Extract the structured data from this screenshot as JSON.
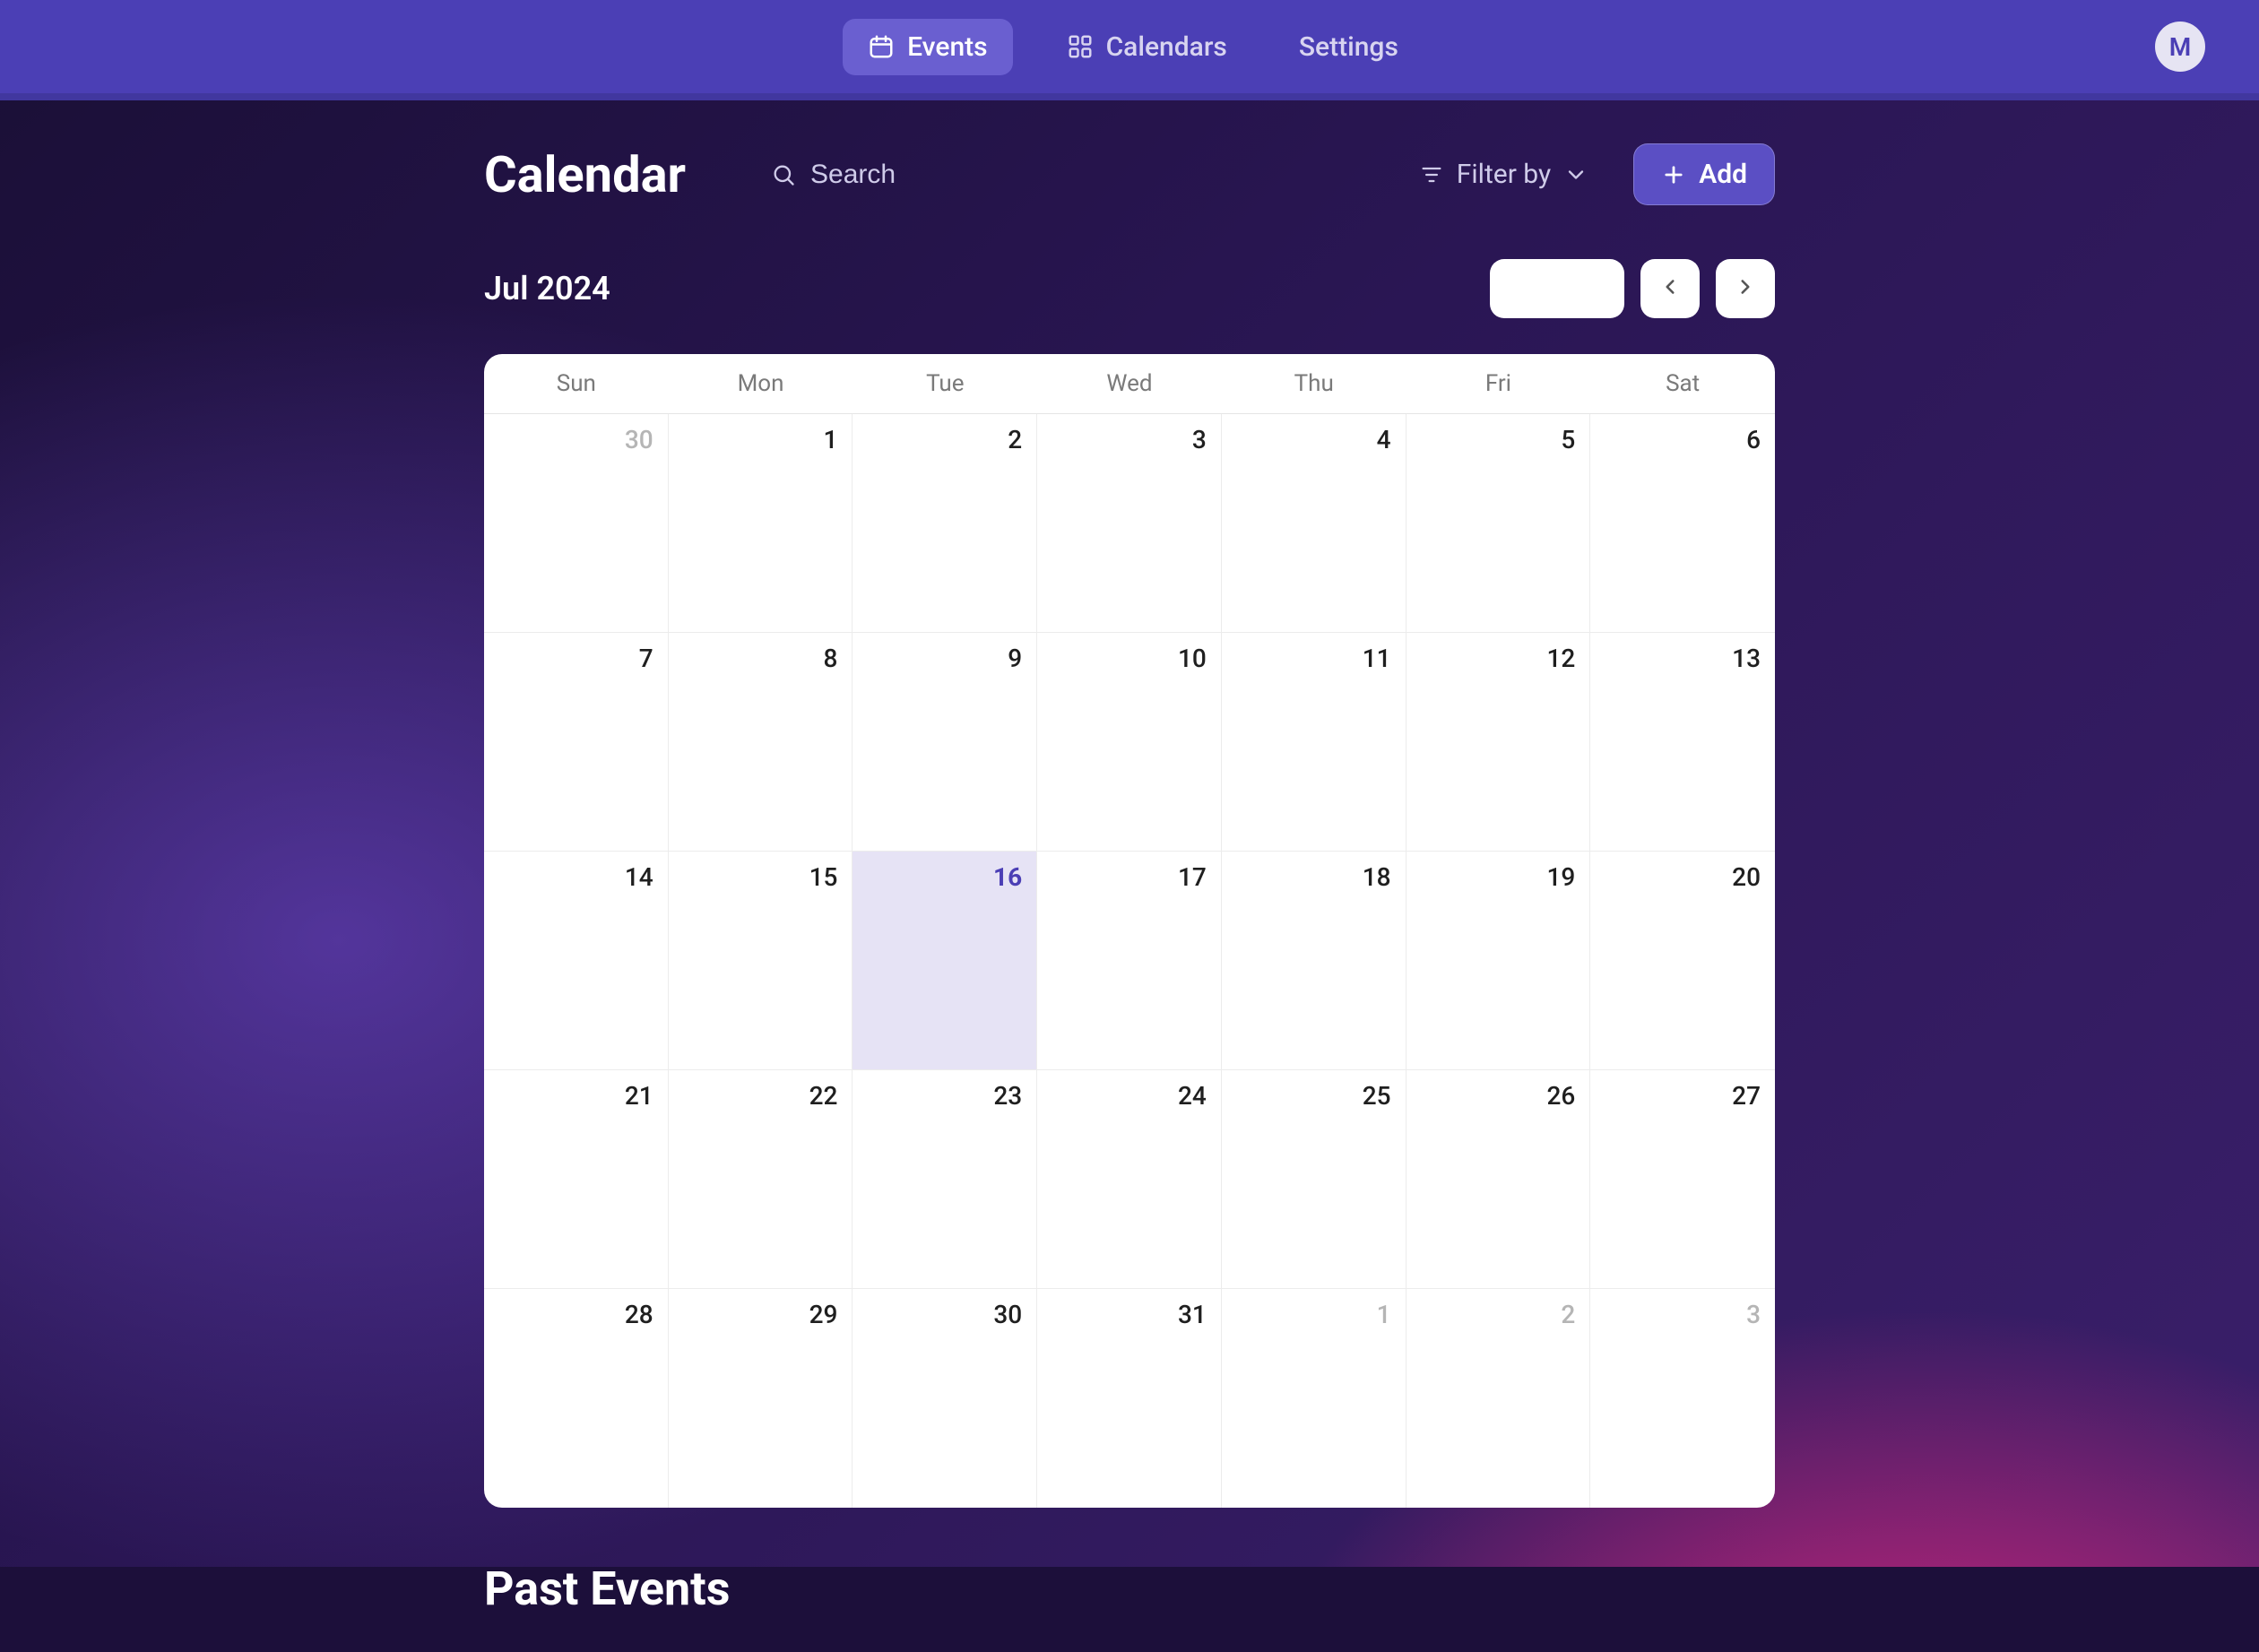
{
  "nav": {
    "tabs": [
      {
        "id": "events",
        "label": "Events",
        "icon": "calendar-icon",
        "active": true
      },
      {
        "id": "calendars",
        "label": "Calendars",
        "icon": "grid-icon",
        "active": false
      },
      {
        "id": "settings",
        "label": "Settings",
        "icon": null,
        "active": false
      }
    ],
    "avatar_initial": "M"
  },
  "header": {
    "title": "Calendar",
    "search_placeholder": "Search",
    "filter_label": "Filter by",
    "add_label": "Add"
  },
  "month": {
    "label": "Jul 2024",
    "today_label": ""
  },
  "weekdays": [
    "Sun",
    "Mon",
    "Tue",
    "Wed",
    "Thu",
    "Fri",
    "Sat"
  ],
  "weeks": [
    [
      {
        "n": "30",
        "outside": true,
        "today": false
      },
      {
        "n": "1",
        "outside": false,
        "today": false
      },
      {
        "n": "2",
        "outside": false,
        "today": false
      },
      {
        "n": "3",
        "outside": false,
        "today": false
      },
      {
        "n": "4",
        "outside": false,
        "today": false
      },
      {
        "n": "5",
        "outside": false,
        "today": false
      },
      {
        "n": "6",
        "outside": false,
        "today": false
      }
    ],
    [
      {
        "n": "7",
        "outside": false,
        "today": false
      },
      {
        "n": "8",
        "outside": false,
        "today": false
      },
      {
        "n": "9",
        "outside": false,
        "today": false
      },
      {
        "n": "10",
        "outside": false,
        "today": false
      },
      {
        "n": "11",
        "outside": false,
        "today": false
      },
      {
        "n": "12",
        "outside": false,
        "today": false
      },
      {
        "n": "13",
        "outside": false,
        "today": false
      }
    ],
    [
      {
        "n": "14",
        "outside": false,
        "today": false
      },
      {
        "n": "15",
        "outside": false,
        "today": false
      },
      {
        "n": "16",
        "outside": false,
        "today": true
      },
      {
        "n": "17",
        "outside": false,
        "today": false
      },
      {
        "n": "18",
        "outside": false,
        "today": false
      },
      {
        "n": "19",
        "outside": false,
        "today": false
      },
      {
        "n": "20",
        "outside": false,
        "today": false
      }
    ],
    [
      {
        "n": "21",
        "outside": false,
        "today": false
      },
      {
        "n": "22",
        "outside": false,
        "today": false
      },
      {
        "n": "23",
        "outside": false,
        "today": false
      },
      {
        "n": "24",
        "outside": false,
        "today": false
      },
      {
        "n": "25",
        "outside": false,
        "today": false
      },
      {
        "n": "26",
        "outside": false,
        "today": false
      },
      {
        "n": "27",
        "outside": false,
        "today": false
      }
    ],
    [
      {
        "n": "28",
        "outside": false,
        "today": false
      },
      {
        "n": "29",
        "outside": false,
        "today": false
      },
      {
        "n": "30",
        "outside": false,
        "today": false
      },
      {
        "n": "31",
        "outside": false,
        "today": false
      },
      {
        "n": "1",
        "outside": true,
        "today": false
      },
      {
        "n": "2",
        "outside": true,
        "today": false
      },
      {
        "n": "3",
        "outside": true,
        "today": false
      }
    ]
  ],
  "sections": {
    "past_events": "Past Events"
  },
  "colors": {
    "accent": "#5b4fc4",
    "topbar": "#4b3fb5"
  }
}
